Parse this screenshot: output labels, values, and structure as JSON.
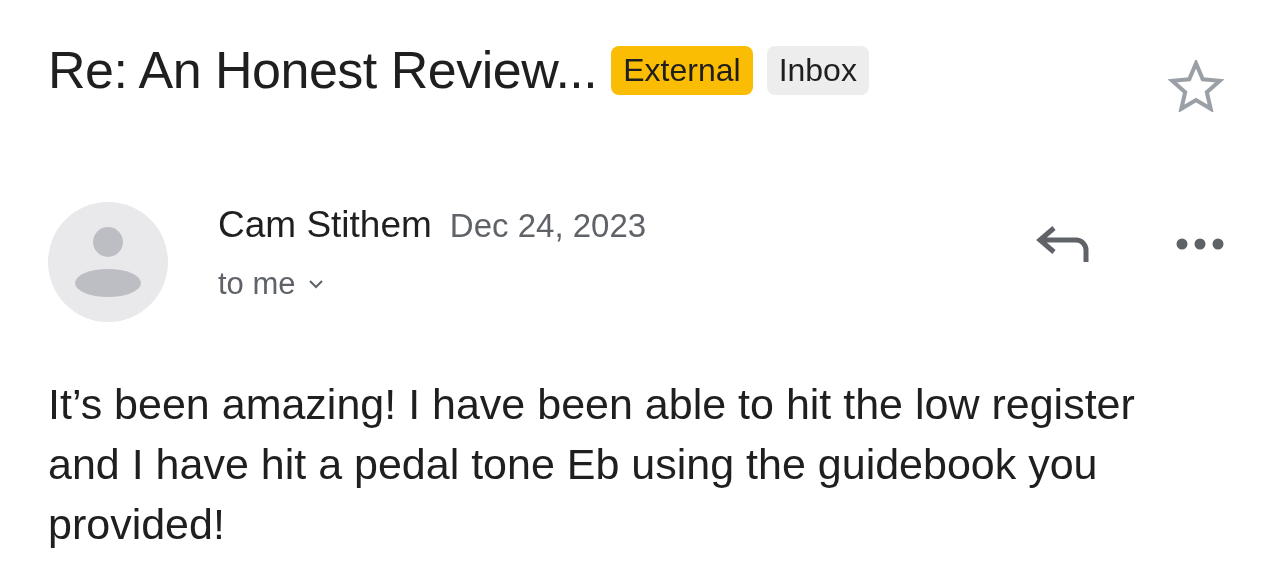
{
  "subject": {
    "title": "Re: An Honest Review...",
    "labels": [
      {
        "text": "External",
        "kind": "external"
      },
      {
        "text": "Inbox",
        "kind": "folder"
      }
    ],
    "starred": false
  },
  "message": {
    "sender": "Cam Stithem",
    "date": "Dec 24, 2023",
    "recipient": "to me",
    "body": "It’s been amazing! I have been able to hit the low register and I have hit a pedal tone Eb using the guidebook you provided!"
  }
}
